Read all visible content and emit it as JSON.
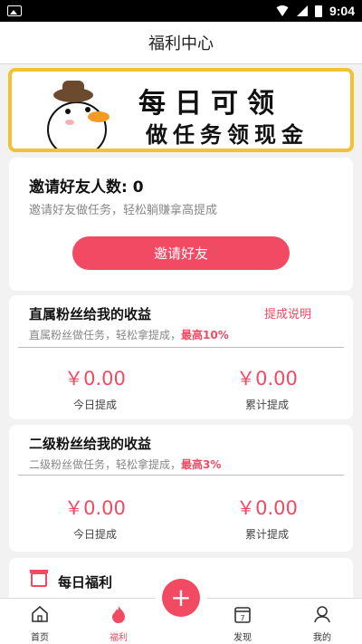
{
  "status": {
    "time": "9:04"
  },
  "title": "福利中心",
  "banner": {
    "line1": "每日可领",
    "line2": "做任务领现金"
  },
  "invite": {
    "count_label": "邀请好友人数: 0",
    "desc": "邀请好友做任务，轻松躺赚拿高提成",
    "button": "邀请好友"
  },
  "direct": {
    "title": "直属粉丝给我的收益",
    "link": "提成说明",
    "sub": "直属粉丝做任务，轻松拿提成，",
    "highlight": "最高10%",
    "today_amount": "￥0.00",
    "today_label": "今日提成",
    "total_amount": "￥0.00",
    "total_label": "累计提成"
  },
  "second": {
    "title": "二级粉丝给我的收益",
    "sub": "二级粉丝做任务，轻松拿提成，",
    "highlight": "最高3%",
    "today_amount": "￥0.00",
    "today_label": "今日提成",
    "total_amount": "￥0.00",
    "total_label": "累计提成"
  },
  "daily": {
    "title": "每日福利"
  },
  "tabs": {
    "home": "首页",
    "welfare": "福利",
    "discover": "发现",
    "discover_badge": "7",
    "mine": "我的",
    "fab": "+"
  },
  "colors": {
    "accent": "#f34a63",
    "banner_border": "#f2c230"
  }
}
